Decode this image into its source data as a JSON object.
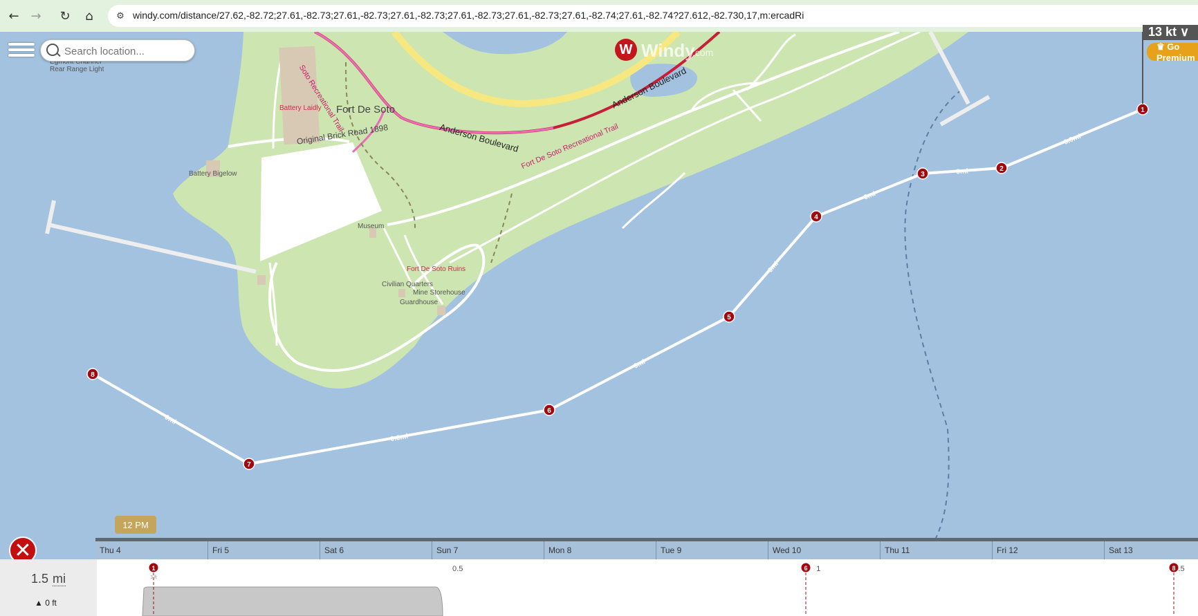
{
  "browser": {
    "url": "windy.com/distance/27.62,-82.72;27.61,-82.73;27.61,-82.73;27.61,-82.73;27.61,-82.73;27.61,-82.73;27.61,-82.74;27.61,-82.74?27.612,-82.730,17,m:ercadRi",
    "back_icon": "←",
    "forward_icon": "→",
    "reload_icon": "↻",
    "home_icon": "⌂",
    "site_info_icon": "⚙"
  },
  "search": {
    "placeholder": "Search location..."
  },
  "logo": {
    "text": "Windy",
    "suffix": ".com",
    "badge": "W"
  },
  "wind_box": {
    "text": "13 kt ∨"
  },
  "premium": {
    "label": "♛ Go Premium"
  },
  "map_labels": {
    "top_left": [
      "Egmont Channel",
      "Rear Range Light"
    ],
    "battery_laidly": "Battery Laidly",
    "fort_de_soto": "Fort De Soto",
    "battery_bigelow": "Battery Bigelow",
    "anderson_blvd_1": "Anderson Boulevard",
    "anderson_blvd_2": "Anderson Boulevard",
    "trail_1": "Fort De Soto Recreational Trail",
    "trail_2": "Fort De Soto Recreational Trail",
    "trail_3": "Soto Recreational Trail",
    "brick_road": "Original Brick Road 1898",
    "museum": "Museum",
    "ruins": "Fort De Soto Ruins",
    "civilian": "Civilian Quarters",
    "mine": "Mine Storehouse",
    "guardhouse": "Guardhouse"
  },
  "route": {
    "points": [
      {
        "n": "1"
      },
      {
        "n": "2"
      },
      {
        "n": "3"
      },
      {
        "n": "4"
      },
      {
        "n": "5"
      },
      {
        "n": "6"
      },
      {
        "n": "7"
      },
      {
        "n": "8"
      }
    ],
    "segments": [
      "0.9mi",
      "0mi",
      "0mi",
      "0mi",
      "0mi",
      "0.6mi",
      "0mi"
    ]
  },
  "timeline": {
    "current_time": "12 PM",
    "days": [
      "Thu 4",
      "Fri 5",
      "Sat 6",
      "Sun 7",
      "Mon 8",
      "Tue 9",
      "Wed 10",
      "Thu 11",
      "Fri 12",
      "Sat 13"
    ]
  },
  "elevation": {
    "total_distance": "1.5",
    "distance_unit": "mi",
    "elevation": "0 ft",
    "axis_ticks": [
      "0.5",
      "1",
      "1.5"
    ],
    "markers": [
      "1",
      "6",
      "8"
    ],
    "marker_1_sub": "3 ft"
  },
  "colors": {
    "water": "#a2c2e0",
    "land": "#cde5b0",
    "route_point": "#a3080f",
    "trail": "#e3358f"
  }
}
